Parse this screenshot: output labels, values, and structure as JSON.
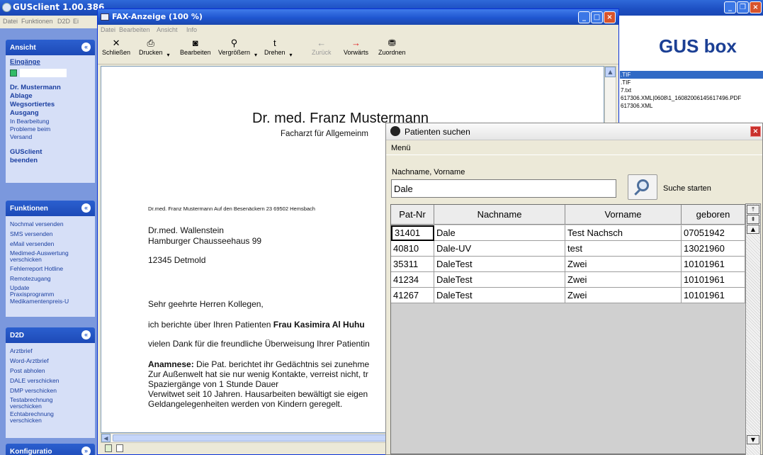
{
  "main_window": {
    "title": "GUSclient 1.00.386",
    "menu": [
      "Datei",
      "Funktionen",
      "D2D",
      "Ei"
    ]
  },
  "sidebar": {
    "ansicht": {
      "header": "Ansicht",
      "items": [
        {
          "label": "Eingänge",
          "style": "bold-underline"
        },
        {
          "label": "Dr. Mustermann",
          "style": "bold"
        },
        {
          "label": "Ablage",
          "style": "bold"
        },
        {
          "label": "Wegsortiertes",
          "style": "bold"
        },
        {
          "label": "Ausgang",
          "style": "bold"
        },
        {
          "label": "In Bearbeitung",
          "style": "normal"
        },
        {
          "label": "Probleme beim Versand",
          "style": "normal"
        },
        {
          "label": "GUSclient beenden",
          "style": "bold"
        }
      ]
    },
    "funktionen": {
      "header": "Funktionen",
      "items": [
        "Nochmal versenden",
        "SMS versenden",
        "eMail versenden",
        "Medimed-Auswertung verschicken",
        "Fehlerreport Hotline",
        "Remotezugang",
        "Update Praxisprogramm",
        "Medikamentenpreis-U"
      ]
    },
    "d2d": {
      "header": "D2D",
      "items": [
        "Arztbrief",
        "Word-Arztbrief",
        "Post abholen",
        "DALE verschicken",
        "DMP verschicken",
        "Testabrechnung verschicken",
        "Echtabrechnung verschicken"
      ]
    },
    "konfiguration": {
      "header": "Konfiguratio"
    }
  },
  "gusbox": {
    "logo_gus": "GUS",
    "logo_box": "box",
    "files": [
      {
        "name": ".TIF",
        "selected": true
      },
      {
        "name": ".TIF",
        "selected": false
      },
      {
        "name": "7.txt",
        "selected": false
      },
      {
        "name": "617306.XML|0608\\1_16082006145617496.PDF",
        "selected": false
      },
      {
        "name": "617306.XML",
        "selected": false
      }
    ]
  },
  "fax_window": {
    "title": "FAX-Anzeige (100 %)",
    "menu": [
      "Datei",
      "Bearbeiten",
      "Ansicht",
      "Info"
    ],
    "toolbar": [
      {
        "label": "Schließen",
        "icon": "close-icon",
        "enabled": true
      },
      {
        "label": "Drucken",
        "icon": "printer-icon",
        "enabled": true
      },
      {
        "label": "Bearbeiten",
        "icon": "camera-icon",
        "enabled": true
      },
      {
        "label": "Vergrößern",
        "icon": "zoom-icon",
        "enabled": true
      },
      {
        "label": "Drehen",
        "icon": "rotate-icon",
        "enabled": true
      },
      {
        "label": "Zurück",
        "icon": "arrow-left-icon",
        "enabled": false
      },
      {
        "label": "Vorwärts",
        "icon": "arrow-right-icon",
        "enabled": true
      },
      {
        "label": "Zuordnen",
        "icon": "assign-icon",
        "enabled": true
      }
    ],
    "document": {
      "heading": "Dr. med. Franz Mustermann",
      "subheading": "Facharzt für Allgemeinm",
      "sender_line": "Dr.med. Franz Mustermann Auf den Besenäckern 23 69502 Hemsbach",
      "recipient": [
        "Dr.med. Wallenstein",
        "Hamburger Chausseehaus 99",
        "12345 Detmold"
      ],
      "salutation": "Sehr geehrte Herren Kollegen,",
      "para1_prefix": "ich berichte über Ihren Patienten ",
      "para1_bold": "Frau  Kasimira  Al Huhu",
      "para2": "vielen Dank für die freundliche Überweisung Ihrer Patientin",
      "anamnese_label": "Anamnese:",
      "anamnese_lines": [
        " Die Pat. berichtet ihr Gedächtnis sei zunehme",
        "Zur Außenwelt hat sie nur wenig Kontakte, verreist nicht, tr",
        "Spaziergänge von 1 Stunde Dauer",
        "Verwitwet seit 10 Jahren. Hausarbeiten bewältigt sie eigen",
        "Geldangelegenheiten werden von Kindern geregelt."
      ]
    }
  },
  "patient_dialog": {
    "title": "Patienten suchen",
    "menu": "Menü",
    "search_label": "Nachname, Vorname",
    "search_value": "Dale",
    "search_button_label": "Suche starten",
    "columns": [
      "Pat-Nr",
      "Nachname",
      "Vorname",
      "geboren"
    ],
    "rows": [
      [
        "31401",
        "Dale",
        "Test Nachsch",
        "07051942"
      ],
      [
        "40810",
        "Dale-UV",
        "test",
        "13021960"
      ],
      [
        "35311",
        "DaleTest",
        "Zwei",
        "10101961"
      ],
      [
        "41234",
        "DaleTest",
        "Zwei",
        "10101961"
      ],
      [
        "41267",
        "DaleTest",
        "Zwei",
        "10101961"
      ]
    ]
  }
}
